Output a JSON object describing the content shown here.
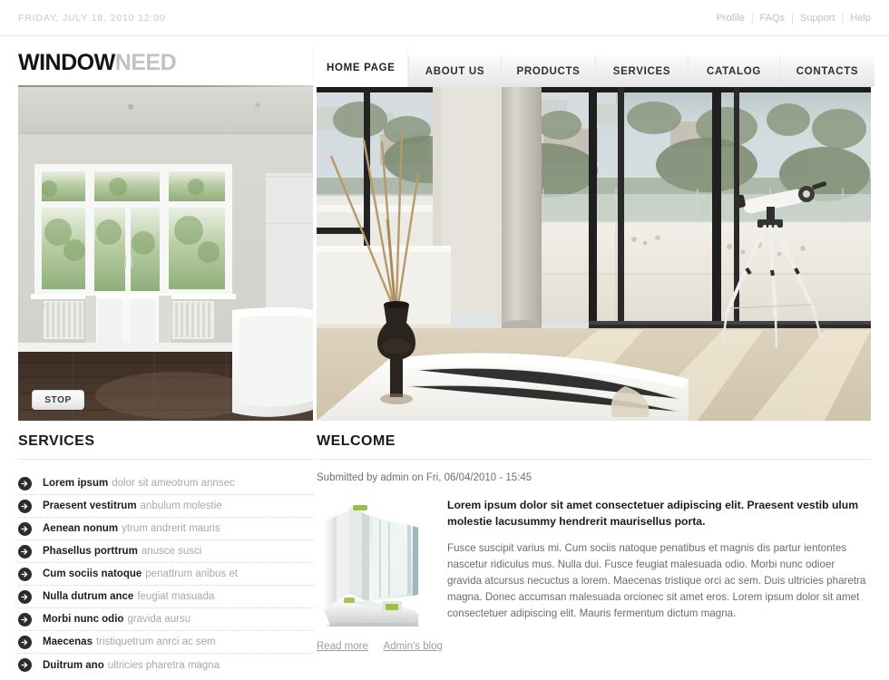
{
  "topbar": {
    "date": "FRIDAY, JULY 18, 2010 12:00",
    "links": [
      {
        "label": "Profile"
      },
      {
        "label": "FAQs"
      },
      {
        "label": "Support"
      },
      {
        "label": "Help"
      }
    ],
    "separator": "|"
  },
  "logo": {
    "primary": "WINDOW",
    "secondary": "NEED"
  },
  "nav": {
    "tabs": [
      {
        "label": "HOME PAGE",
        "active": true
      },
      {
        "label": "ABOUT US",
        "active": false
      },
      {
        "label": "PRODUCTS",
        "active": false
      },
      {
        "label": "SERVICES",
        "active": false
      },
      {
        "label": "CATALOG",
        "active": false
      },
      {
        "label": "CONTACTS",
        "active": false
      }
    ]
  },
  "hero": {
    "left_image_alt": "White French doors and windows in a bathroom with radiators, dark wood floor and a freestanding bathtub",
    "right_image_alt": "Modern bedroom with floor-to-ceiling glass windows, ocean and hillside view, telescope on a tripod and bamboo stems in a dark vase",
    "stop_button": "STOP"
  },
  "services": {
    "title": "SERVICES",
    "icon": "arrow-right-circle-icon",
    "items": [
      {
        "bold": "Lorem ipsum",
        "rest": "dolor sit ameotrum annsec"
      },
      {
        "bold": "Praesent vestitrum",
        "rest": "anbulum molestie"
      },
      {
        "bold": "Aenean nonum",
        "rest": "ytrum andrerit mauris"
      },
      {
        "bold": "Phasellus porttrum",
        "rest": "anusce susci"
      },
      {
        "bold": "Cum sociis natoque",
        "rest": "penattrum anibus et"
      },
      {
        "bold": "Nulla dutrum ance",
        "rest": "feugiat masuada"
      },
      {
        "bold": "Morbi nunc odio",
        "rest": "gravida aursu"
      },
      {
        "bold": "Maecenas",
        "rest": "tristiquetrum anrci ac sem"
      },
      {
        "bold": "Duitrum ano",
        "rest": "ultricies pharetra magna"
      }
    ]
  },
  "welcome": {
    "title": "WELCOME",
    "submitted": "Submitted by admin on Fri, 06/04/2010 - 15:45",
    "thumb_alt": "Cross-section diagram of a white PVC window profile with double glazing",
    "lead": "Lorem ipsum dolor sit amet consectetuer adipiscing elit. Praesent vestib ulum molestie lacusummy hendrerit maurisellus porta.",
    "body": "Fusce suscipit varius mi. Cum sociis natoque penatibus et magnis dis partur ientontes nascetur ridiculus mus. Nulla dui. Fusce feugiat malesuada odio. Morbi nunc odioer gravida atcursus necuctus a lorem. Maecenas tristique orci ac sem. Duis ultricies pharetra magna. Donec accumsan malesuada orcionec sit amet eros. Lorem ipsum dolor sit amet consectetuer adipiscing elit. Mauris fermentum dictum magna.",
    "links": [
      {
        "label": "Read more"
      },
      {
        "label": "Admin's blog"
      }
    ]
  },
  "colors": {
    "logo_dark": "#141414",
    "logo_light": "#c2c2c2",
    "icon_dark": "#2c2c2c",
    "muted_text": "#a8a8a8",
    "rule": "#e6e6e6"
  }
}
